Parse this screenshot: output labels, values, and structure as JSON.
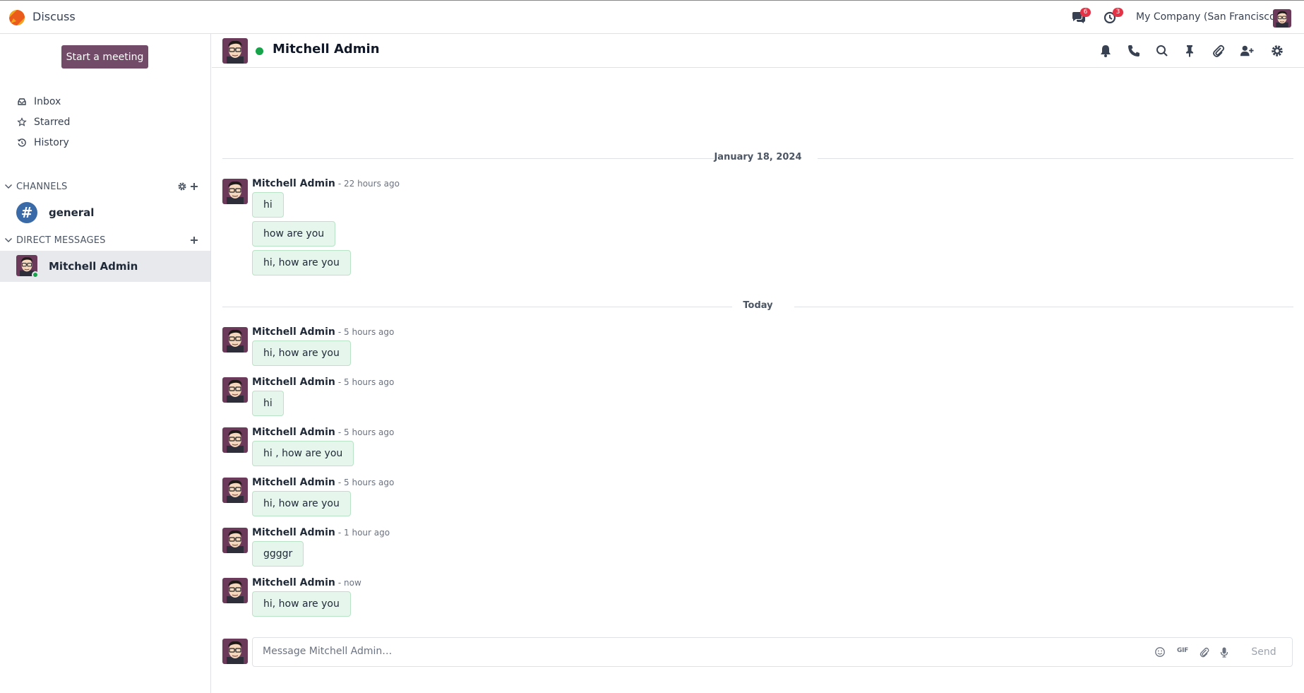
{
  "navbar": {
    "app_name": "Discuss",
    "messages_badge": "6",
    "activities_badge": "3",
    "company": "My Company (San Francisco)"
  },
  "sidebar": {
    "start_meeting": "Start a meeting",
    "mailboxes": [
      {
        "label": "Inbox",
        "icon": "inbox-icon"
      },
      {
        "label": "Starred",
        "icon": "star-icon"
      },
      {
        "label": "History",
        "icon": "history-icon"
      }
    ],
    "channels_header": "CHANNELS",
    "channels": [
      {
        "label": "general"
      }
    ],
    "dm_header": "DIRECT MESSAGES",
    "direct_messages": [
      {
        "label": "Mitchell Admin",
        "status": "online"
      }
    ]
  },
  "thread": {
    "name": "Mitchell Admin",
    "actions": [
      "bell-icon",
      "phone-icon",
      "search-icon",
      "pin-icon",
      "paperclip-icon",
      "add-user-icon",
      "gear-icon"
    ]
  },
  "messages": {
    "sep1": "January 18, 2024",
    "sep2": "Today",
    "groups": [
      {
        "author": "Mitchell Admin",
        "time": "- 22 hours ago",
        "bodies": [
          "hi",
          "how are you",
          "hi, how are you"
        ]
      },
      {
        "author": "Mitchell Admin",
        "time": "- 5 hours ago",
        "bodies": [
          "hi, how are you"
        ]
      },
      {
        "author": "Mitchell Admin",
        "time": "- 5 hours ago",
        "bodies": [
          "hi"
        ]
      },
      {
        "author": "Mitchell Admin",
        "time": "- 5 hours ago",
        "bodies": [
          "hi , how are you"
        ]
      },
      {
        "author": "Mitchell Admin",
        "time": "- 5 hours ago",
        "bodies": [
          "hi, how are you"
        ]
      },
      {
        "author": "Mitchell Admin",
        "time": "- 1 hour ago",
        "bodies": [
          "ggggr"
        ]
      },
      {
        "author": "Mitchell Admin",
        "time": "- now",
        "bodies": [
          "hi, how are you"
        ]
      }
    ]
  },
  "composer": {
    "placeholder": "Message Mitchell Admin…",
    "gif": "GIF",
    "send": "Send"
  },
  "colors": {
    "brand": "#714b67",
    "bubble": "#e6f6ec",
    "online": "#16a34a",
    "badge": "#e23347",
    "channel": "#3b6aa8"
  }
}
